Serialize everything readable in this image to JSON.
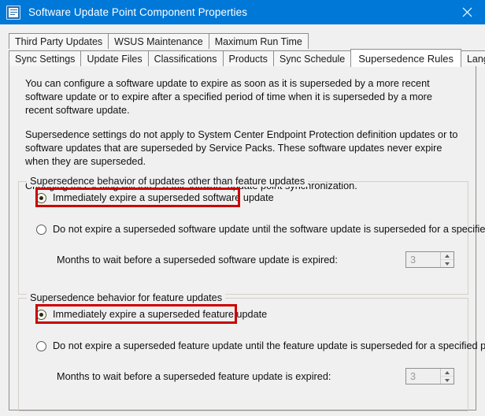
{
  "window": {
    "title": "Software Update Point Component Properties",
    "icon": "properties-sheet-icon",
    "close_label": "✕",
    "accent_color": "#0078d7",
    "panel_color": "#f0f0f0",
    "highlight_color": "#cc0000"
  },
  "tabs": {
    "row1": [
      {
        "label": "Third Party Updates",
        "active": false
      },
      {
        "label": "WSUS Maintenance",
        "active": false
      },
      {
        "label": "Maximum Run Time",
        "active": false
      }
    ],
    "row2": [
      {
        "label": "Sync Settings",
        "active": false
      },
      {
        "label": "Update Files",
        "active": false
      },
      {
        "label": "Classifications",
        "active": false
      },
      {
        "label": "Products",
        "active": false
      },
      {
        "label": "Sync Schedule",
        "active": false
      },
      {
        "label": "Supersedence Rules",
        "active": true
      },
      {
        "label": "Languages",
        "active": false
      }
    ]
  },
  "intro": {
    "paragraph1": "You can configure a software update to expire as soon as it is superseded by a more recent software update or to expire after a specified period of time when it is superseded by a more recent software update.",
    "paragraph2": "Supersedence settings do not apply to System Center Endpoint Protection definition updates or to software updates that are superseded by Service Packs. These software updates never expire when they are superseded.",
    "paragraph3": "Changing this setting will force a full software update point synchronization."
  },
  "group_software": {
    "legend": "Supersedence behavior of updates other than feature updates",
    "option_immediate": {
      "label": "Immediately expire a superseded software update",
      "checked": true,
      "highlighted": true
    },
    "option_delayed": {
      "label": "Do not expire a superseded software update until the software update is superseded for a specified period",
      "checked": false,
      "highlighted": false
    },
    "months": {
      "label": "Months to wait before a superseded software update is expired:",
      "value": "3",
      "disabled": true
    }
  },
  "group_feature": {
    "legend": "Supersedence behavior for feature updates",
    "option_immediate": {
      "label": "Immediately expire a superseded feature update",
      "checked": true,
      "highlighted": true
    },
    "option_delayed": {
      "label": "Do not expire a superseded feature update until the feature update is superseded for a specified period",
      "checked": false,
      "highlighted": false
    },
    "months": {
      "label": "Months to wait before a superseded feature update is expired:",
      "value": "3",
      "disabled": true
    }
  }
}
